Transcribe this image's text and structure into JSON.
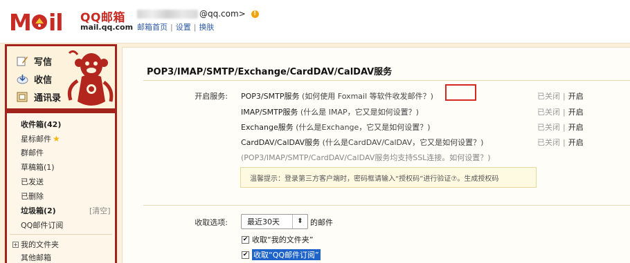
{
  "header": {
    "logo_text": "MOil",
    "brand": "QQ邮箱",
    "domain": "mail.qq.com",
    "account_suffix": "@qq.com>",
    "warning": "!",
    "links": [
      "邮箱首页",
      "设置",
      "换肤"
    ],
    "separator": "|",
    "accent_color": "#c82b23"
  },
  "sidebar": {
    "actions": [
      {
        "label": "写信",
        "icon": "compose-icon"
      },
      {
        "label": "收信",
        "icon": "inbox-receive-icon"
      },
      {
        "label": "通讯录",
        "icon": "contacts-icon"
      }
    ],
    "folders": [
      {
        "label": "收件箱(42)",
        "bold": true
      },
      {
        "label": "星标邮件",
        "star": "★"
      },
      {
        "label": "群邮件"
      },
      {
        "label": "草稿箱(1)"
      },
      {
        "label": "已发送"
      },
      {
        "label": "已删除"
      },
      {
        "label": "垃圾箱(2)",
        "bold": true,
        "action": "[清空]"
      },
      {
        "label": "QQ邮件订阅"
      }
    ],
    "my_folders": {
      "expander": "+",
      "label": "我的文件夹"
    },
    "other_mail": "其他邮箱",
    "frame_color": "#a2231b"
  },
  "main": {
    "title": "POP3/IMAP/SMTP/Exchange/CardDAV/CalDAV服务",
    "enable_label": "开启服务:",
    "services": [
      {
        "name": "POP3/SMTP服务",
        "help": "(如何使用 Foxmail 等软件收发邮件？)",
        "status_off": "已关闭",
        "status_on": "开启"
      },
      {
        "name": "IMAP/SMTP服务",
        "help": "(什么是 IMAP，它又是如何设置？)",
        "status_off": "已关闭",
        "status_on": "开启"
      },
      {
        "name": "Exchange服务",
        "help": "(什么是Exchange，它又是如何设置？)",
        "status_off": "已关闭",
        "status_on": "开启"
      },
      {
        "name": "CardDAV/CalDAV服务",
        "help": "(什么是CardDAV/CalDAV，它又是如何设置？)",
        "status_off": "已关闭",
        "status_on": "开启"
      }
    ],
    "status_separator": "|",
    "ssl_note": "(POP3/IMAP/SMTP/CardDAV/CalDAV服务均支持SSL连接。如何设置？)",
    "tip": "温馨提示：登录第三方客户端时，密码框请输入“授权码”进行验证⑦。生成授权码",
    "receive_label": "收取选项:",
    "receive_select": "最近30天",
    "select_arrow": "⬍",
    "receive_suffix": "的邮件",
    "checkboxes": [
      {
        "label": "收取“我的文件夹”",
        "checked": "✔"
      },
      {
        "label": "收取“QQ邮件订阅”",
        "checked": "✔",
        "highlighted": true
      }
    ],
    "highlight_color": "#d3281e"
  }
}
